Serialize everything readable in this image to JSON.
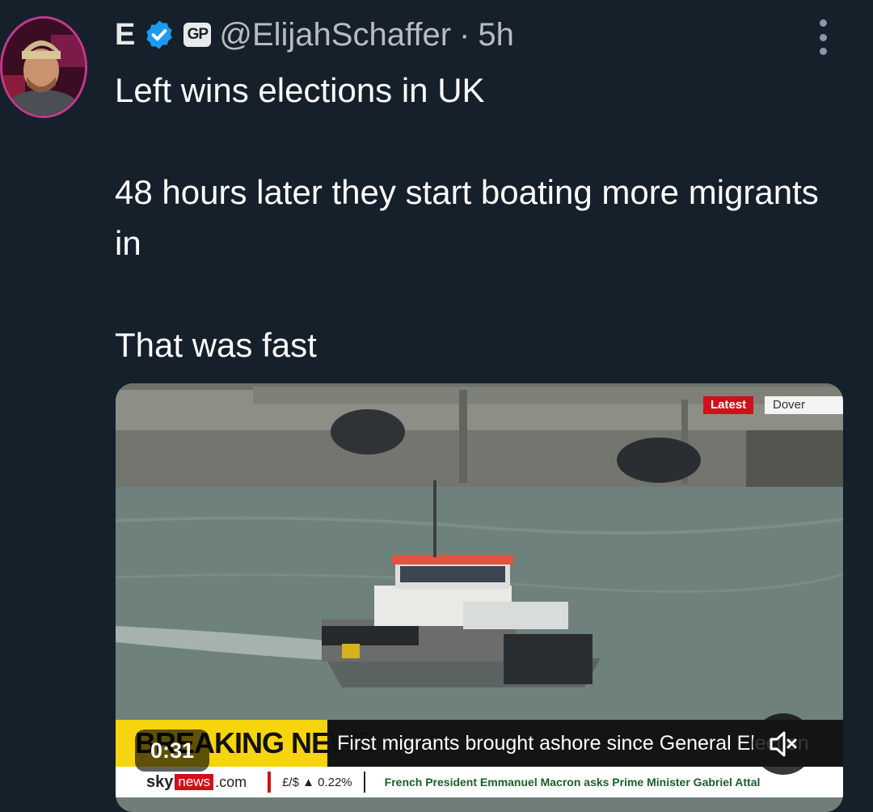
{
  "author": {
    "display_name": "E",
    "affiliation_badge": "GP",
    "handle": "@ElijahSchaffer",
    "separator": "·",
    "time": "5h"
  },
  "tweet": {
    "line1": "Left wins elections in UK",
    "line2": "48 hours later they start boating more migrants in",
    "line3": "That was fast"
  },
  "video": {
    "duration": "0:31",
    "latest_tag": "Latest",
    "location_tag": "Dover",
    "breaking_label": "BREAKING NEWS",
    "headline": "First migrants brought ashore since General Election",
    "brand_sky": "sky",
    "brand_news": "news",
    "brand_com": ".com",
    "market": "£/$ ▲ 0.22%",
    "scroller": "French President Emmanuel Macron asks Prime Minister Gabriel Attal"
  },
  "icons": [
    "verified-badge-icon",
    "more-options-icon",
    "mute-icon"
  ],
  "colors": {
    "background": "#15202b",
    "verified": "#1d9bf0",
    "breaking_yellow": "#f6d40e",
    "sky_red": "#d0101a"
  }
}
